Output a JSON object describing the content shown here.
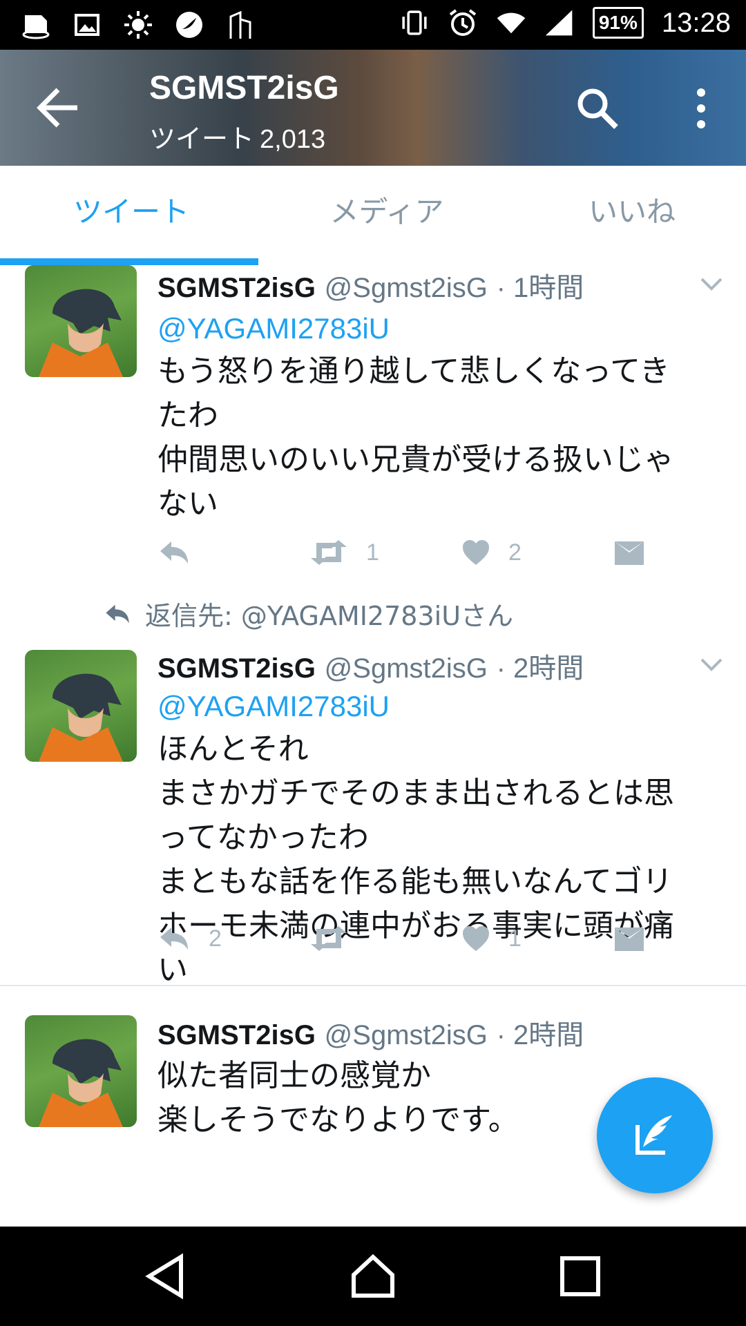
{
  "status_bar": {
    "battery": "91%",
    "time": "13:28",
    "left_icons": [
      "screenshot-icon",
      "image-icon",
      "brightness-icon",
      "app-icon",
      "building-icon"
    ],
    "right_icons": [
      "vibrate-icon",
      "alarm-icon",
      "wifi-icon",
      "signal-icon"
    ]
  },
  "header": {
    "title": "SGMST2isG",
    "subtitle_label": "ツイート",
    "tweet_count": "2,013"
  },
  "tabs": [
    {
      "label": "ツイート",
      "active": true
    },
    {
      "label": "メディア",
      "active": false
    },
    {
      "label": "いいね",
      "active": false
    }
  ],
  "tweets": [
    {
      "name": "SGMST2isG",
      "handle": "@Sgmst2isG",
      "time": "· 1時間",
      "mention": "@YAGAMI2783iU",
      "lines": [
        "もう怒りを通り越して悲しくなってき",
        "たわ",
        "仲間思いのいい兄貴が受ける扱いじゃ",
        "ない"
      ],
      "reply_count": "",
      "retweet_count": "1",
      "like_count": "2"
    },
    {
      "reply_to_label": "返信先:",
      "reply_to_user": "@YAGAMI2783iUさん",
      "name": "SGMST2isG",
      "handle": "@Sgmst2isG",
      "time": "· 2時間",
      "mention": "@YAGAMI2783iU",
      "lines": [
        "ほんとそれ",
        "まさかガチでそのまま出されるとは思",
        "ってなかったわ",
        "まともな話を作る能も無いなんてゴリ",
        "ホーモ未満の連中がおる事実に頭が痛",
        "い"
      ],
      "reply_count": "2",
      "retweet_count": "",
      "like_count": "1"
    },
    {
      "name": "SGMST2isG",
      "handle": "@Sgmst2isG",
      "time": "· 2時間",
      "lines": [
        "似た者同士の感覚か",
        "楽しそうでなりよりです。"
      ]
    }
  ],
  "colors": {
    "accent": "#1da1f2",
    "muted": "#657786",
    "action_gray": "#aab8c2"
  }
}
